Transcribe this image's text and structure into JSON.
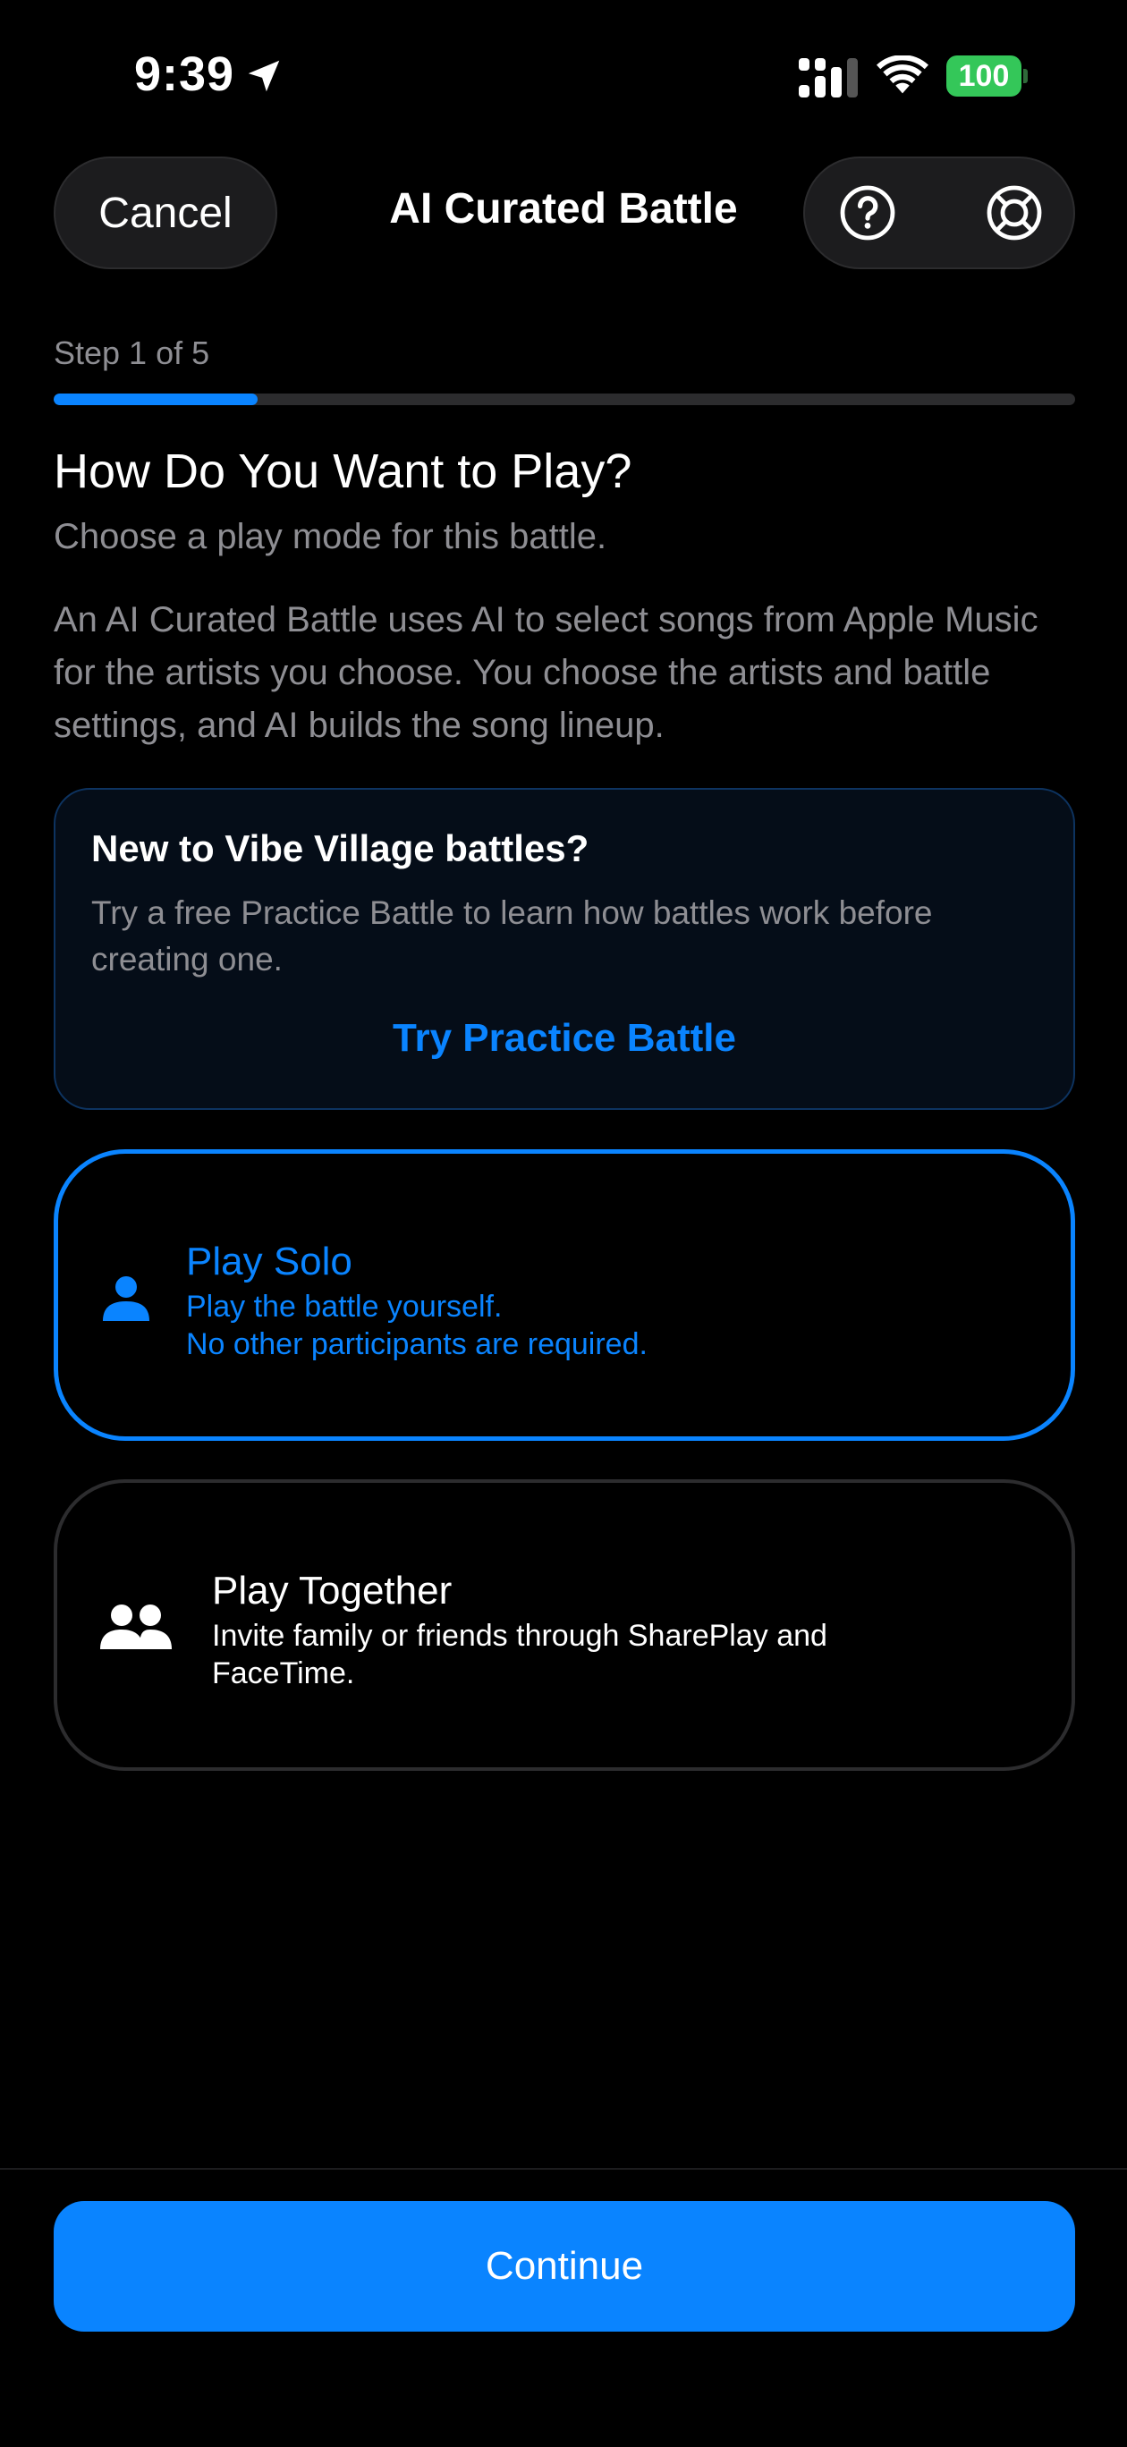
{
  "status_bar": {
    "time": "9:39",
    "battery": "100",
    "icons": [
      "location-arrow-icon",
      "cellular-signal-icon",
      "wifi-icon",
      "battery-icon"
    ],
    "battery_color": "#34c759"
  },
  "nav": {
    "cancel_label": "Cancel",
    "title": "AI Curated Battle",
    "actions": [
      {
        "name": "help-button",
        "icon": "question-circle-icon"
      },
      {
        "name": "support-button",
        "icon": "lifebuoy-icon"
      }
    ]
  },
  "progress": {
    "step_label": "Step 1 of 5",
    "current": 1,
    "total": 5,
    "fraction": 0.2,
    "color": "#0a84ff"
  },
  "content": {
    "heading": "How Do You Want to Play?",
    "subheading": "Choose a play mode for this battle.",
    "description": "An AI Curated Battle uses AI to select songs from Apple Music for the artists you choose. You choose the artists and battle settings, and AI builds the song lineup."
  },
  "practice_card": {
    "title": "New to Vibe Village battles?",
    "body": "Try a free Practice Battle to learn how battles work before creating one.",
    "link_label": "Try Practice Battle"
  },
  "modes": [
    {
      "title": "Play Solo",
      "description_lines": [
        "Play the battle yourself.",
        "No other participants are required."
      ],
      "icon": "person-icon",
      "selected": true
    },
    {
      "title": "Play Together",
      "description_lines": [
        "Invite family or friends through SharePlay and FaceTime."
      ],
      "icon": "two-people-icon",
      "selected": false
    }
  ],
  "footer": {
    "continue_label": "Continue"
  },
  "colors": {
    "accent": "#0a84ff",
    "background": "#000000",
    "secondary_text": "#8e8e93"
  }
}
